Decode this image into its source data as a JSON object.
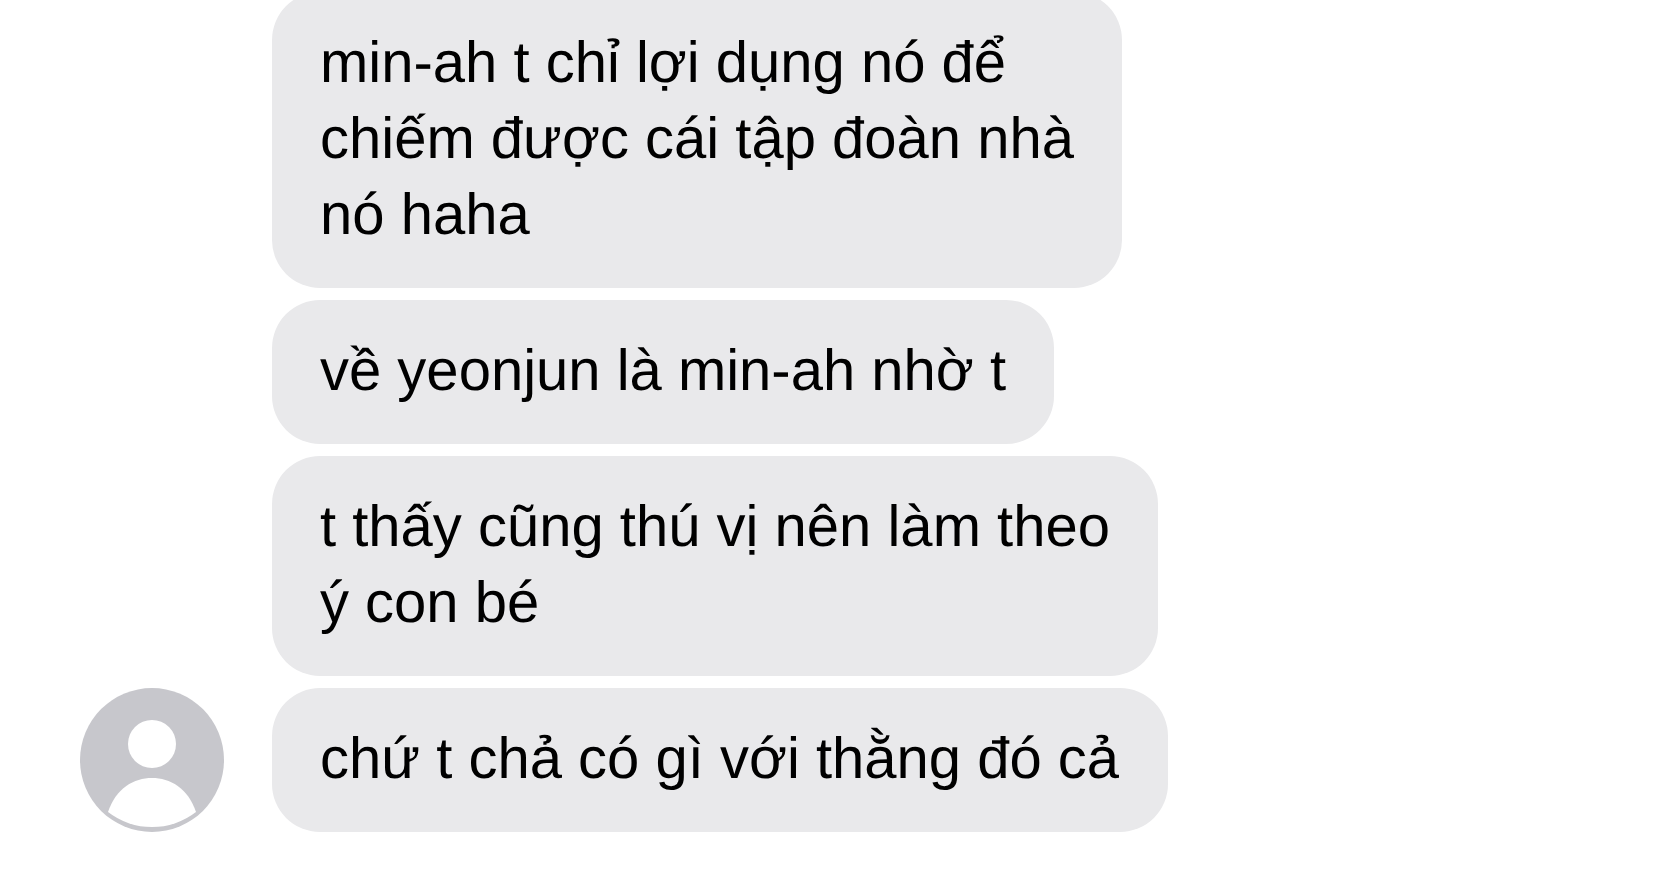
{
  "messages": [
    {
      "text": "min-ah t chỉ lợi dụng nó để\nchiếm được cái tập đoàn nhà\nnó haha",
      "show_avatar": false
    },
    {
      "text": "về yeonjun là min-ah nhờ t",
      "show_avatar": false
    },
    {
      "text": "t thấy cũng thú vị nên làm theo\ný con bé",
      "show_avatar": false
    },
    {
      "text": "chứ t chả có gì với thằng đó cả",
      "show_avatar": true
    }
  ]
}
